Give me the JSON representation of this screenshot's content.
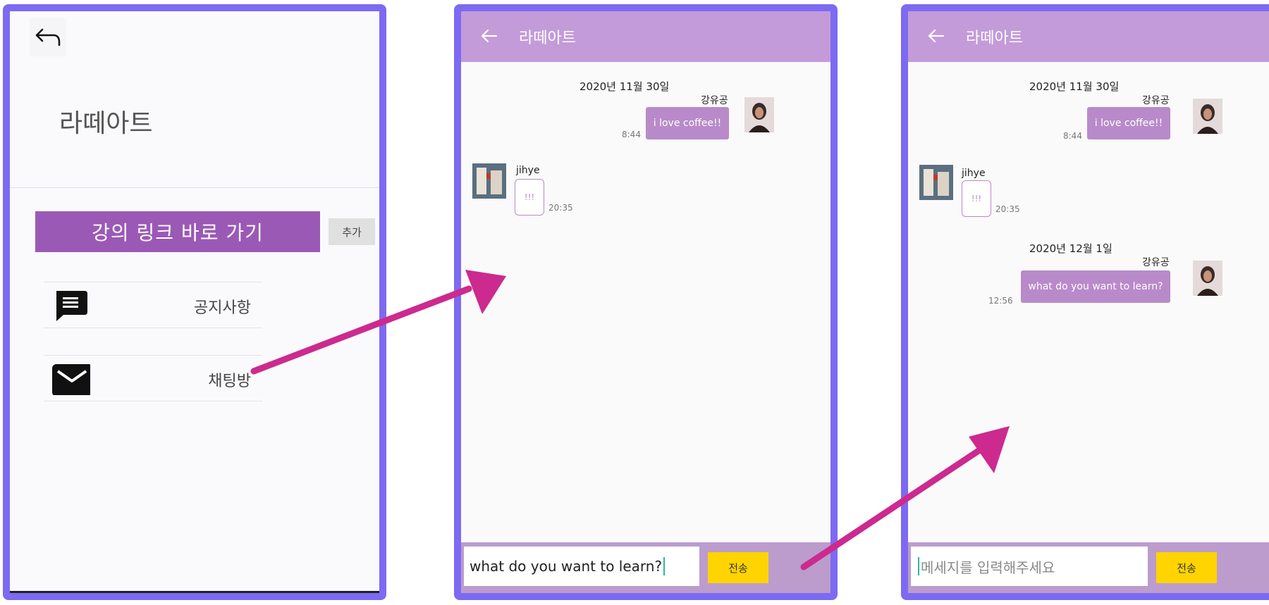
{
  "screen1": {
    "title": "라떼아트",
    "lecture_button": "강의 링크 바로 가기",
    "add_button": "추가",
    "menu": [
      {
        "label": "공지사항",
        "icon": "message-icon"
      },
      {
        "label": "채팅방",
        "icon": "mail-icon"
      }
    ]
  },
  "screen2": {
    "title": "라떼아트",
    "date1": "2020년 11월 30일",
    "msg1": {
      "sender": "강유공",
      "text": "i love coffee!!",
      "time": "8:44"
    },
    "msg2": {
      "sender": "jihye",
      "text": "!!!",
      "time": "20:35"
    },
    "input_value": "what do you want to learn?",
    "send_label": "전송"
  },
  "screen3": {
    "title": "라떼아트",
    "date1": "2020년 11월 30일",
    "msg1": {
      "sender": "강유공",
      "text": "i love coffee!!",
      "time": "8:44"
    },
    "msg2": {
      "sender": "jihye",
      "text": "!!!",
      "time": "20:35"
    },
    "date2": "2020년 12월 1일",
    "msg3": {
      "sender": "강유공",
      "text": "what do you want to learn?",
      "time": "12:56"
    },
    "input_placeholder": "메세지를 입력해주세요",
    "send_label": "전송"
  },
  "colors": {
    "frame": "#7d6af2",
    "appbar": "#c39bd9",
    "bubble": "#b98ac9",
    "send": "#ffd400",
    "arrow": "#cc2a8f",
    "lecture_button": "#9b59b6"
  }
}
